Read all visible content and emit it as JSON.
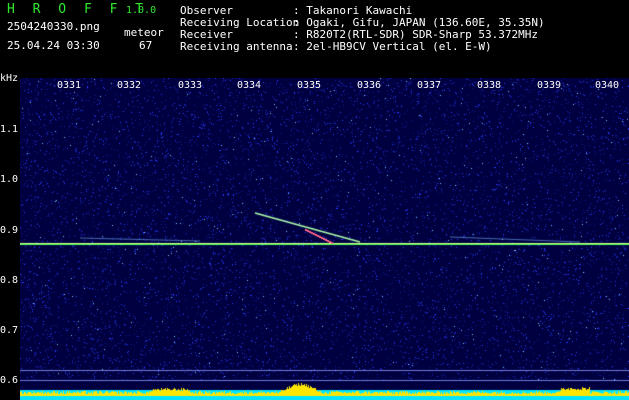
{
  "header": {
    "logo": "H R O F F T",
    "version": "1.0.0",
    "filename": "2504240330.png",
    "datetime": "25.04.24 03:30",
    "meteor_label": "meteor",
    "meteor_count": "67",
    "info": [
      {
        "label": "Observer",
        "value": ": Takanori Kawachi"
      },
      {
        "label": "Receiving Location",
        "value": ": Ogaki, Gifu, JAPAN (136.60E, 35.35N)"
      },
      {
        "label": "Receiver",
        "value": ": R820T2(RTL-SDR) SDR-Sharp 53.372MHz"
      },
      {
        "label": "Receiving antenna",
        "value": ": 2el-HB9CV Vertical (el. E-W)"
      }
    ]
  },
  "chart_data": {
    "type": "heatmap",
    "ylabel": "kHz",
    "x_ticks": [
      "0331",
      "0332",
      "0333",
      "0334",
      "0335",
      "0336",
      "0337",
      "0338",
      "0339",
      "0340"
    ],
    "y_ticks": [
      "1.1",
      "1.0",
      "0.9",
      "0.8",
      "0.7",
      "0.6"
    ],
    "ylim": [
      0.59,
      1.19
    ],
    "carrier_khz": 0.88,
    "colors": {
      "background": "#000040",
      "noise": "#2a3cff",
      "carrier": "#c8ff8c",
      "bottom_bar": "#00e5ff",
      "bottom_peaks": "#ffe600"
    }
  }
}
